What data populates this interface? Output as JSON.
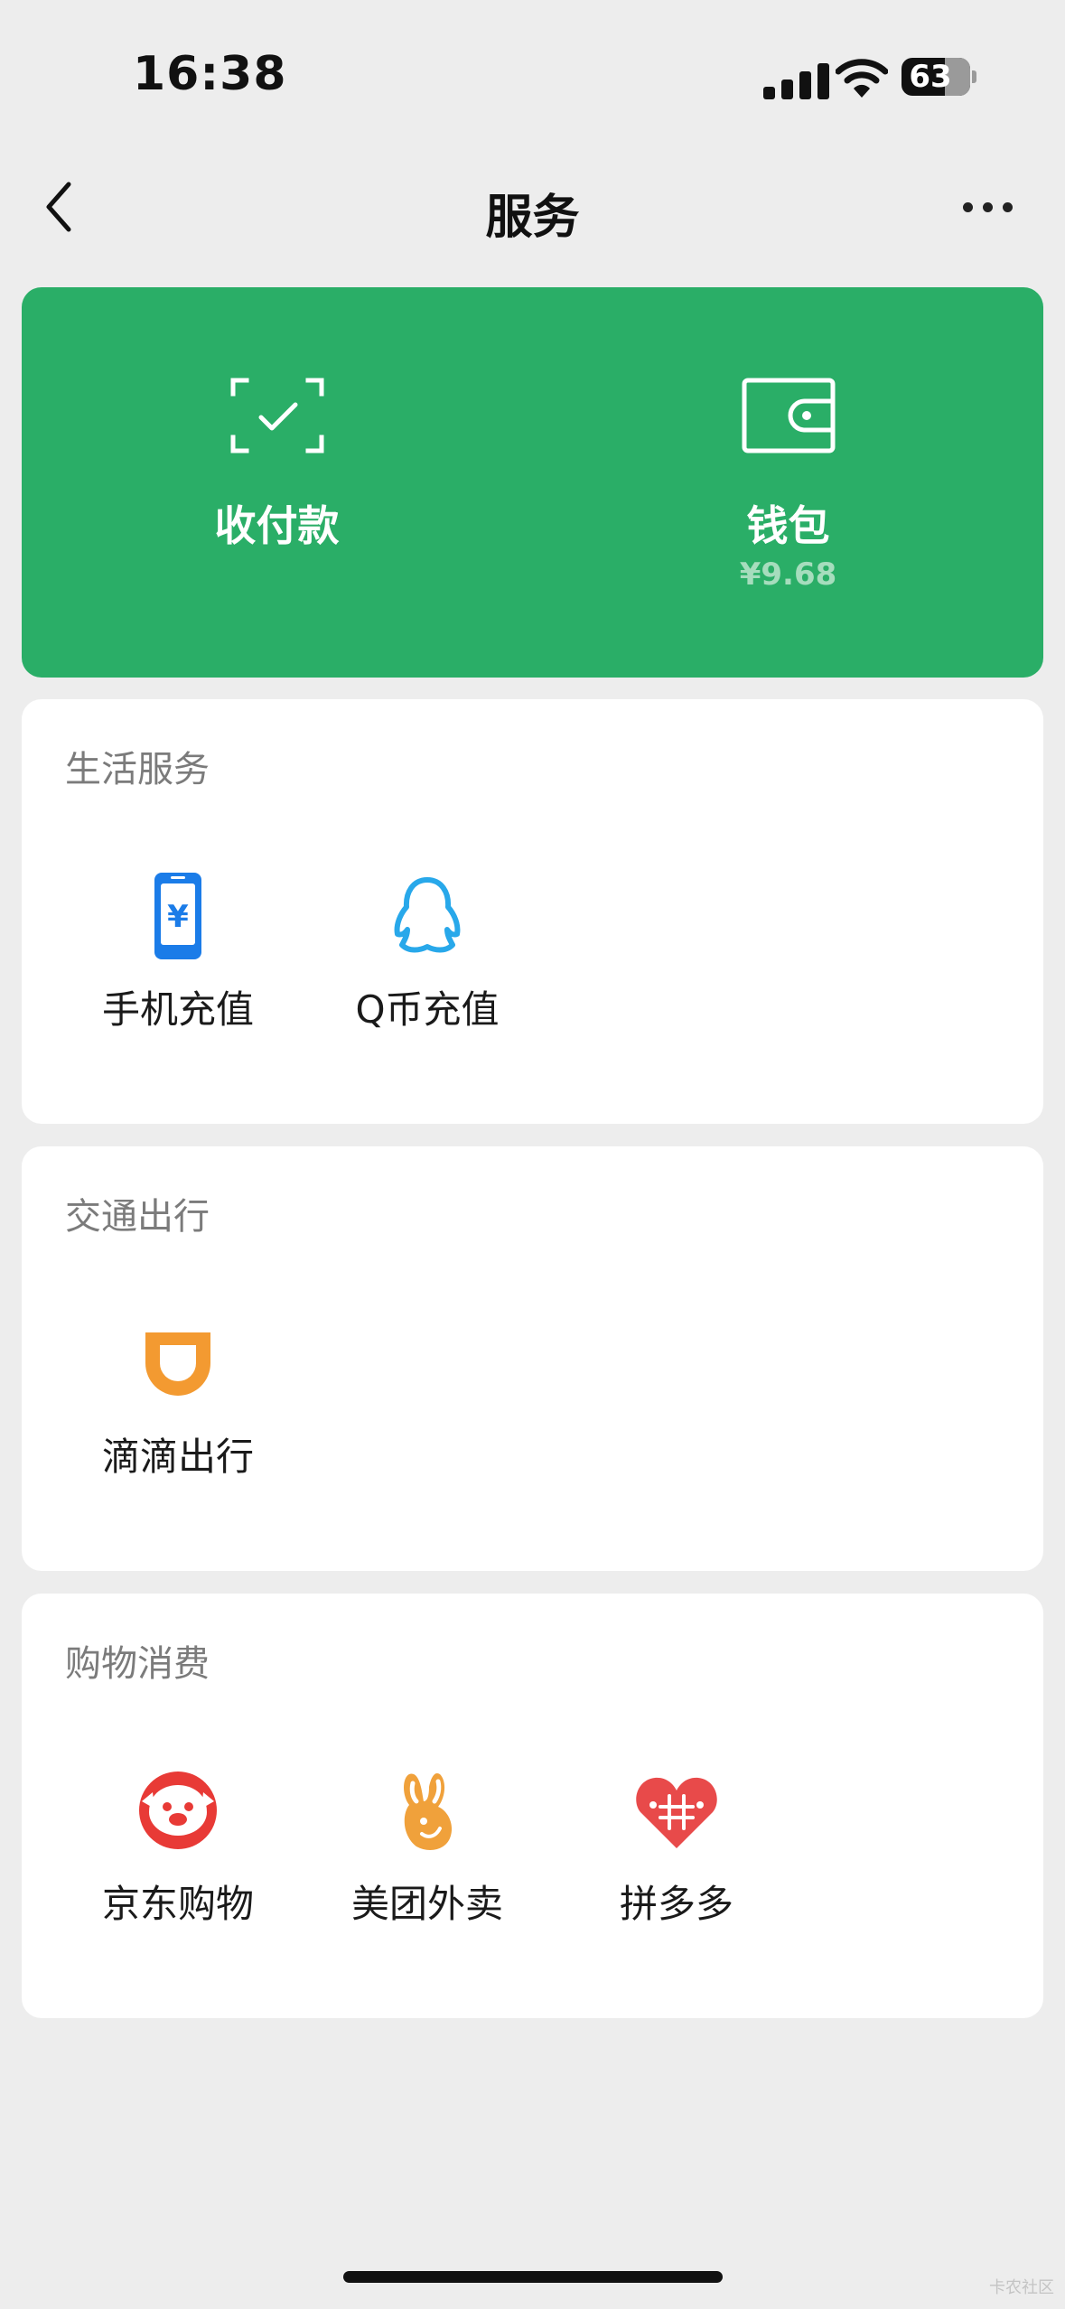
{
  "status_bar": {
    "time": "16:38",
    "battery": "63",
    "battery_level": 0.63
  },
  "nav": {
    "title": "服务"
  },
  "pay_card": {
    "pay": {
      "label": "收付款",
      "icon": "scan-check-icon"
    },
    "wallet": {
      "label": "钱包",
      "balance": "¥9.68",
      "icon": "wallet-icon"
    }
  },
  "sections": [
    {
      "title": "生活服务",
      "items": [
        {
          "label": "手机充值",
          "icon": "phone-recharge-icon"
        },
        {
          "label": "Q币充值",
          "icon": "qq-penguin-icon"
        }
      ]
    },
    {
      "title": "交通出行",
      "items": [
        {
          "label": "滴滴出行",
          "icon": "didi-icon"
        }
      ]
    },
    {
      "title": "购物消费",
      "items": [
        {
          "label": "京东购物",
          "icon": "jd-icon"
        },
        {
          "label": "美团外卖",
          "icon": "meituan-rabbit-icon"
        },
        {
          "label": "拼多多",
          "icon": "pinduoduo-heart-icon"
        }
      ]
    }
  ],
  "watermark": "卡农社区",
  "colors": {
    "accent": "#2aae67",
    "background": "#ededed",
    "jd": "#e83a36",
    "meituan": "#f0a13b",
    "didi": "#f39a31",
    "qq": "#28a8ea",
    "phone": "#1b7ce8",
    "pdd": "#e84a4a"
  }
}
